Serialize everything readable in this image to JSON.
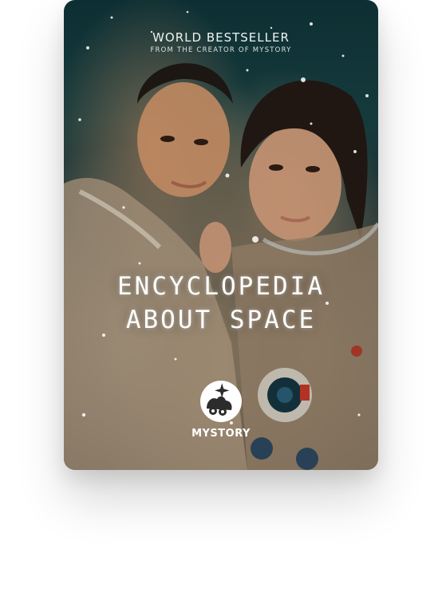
{
  "cover": {
    "kicker": "WORLD BESTSELLER",
    "subkicker": "FROM THE CREATOR OF MYSTORY",
    "title_line_1": "ENCYCLOPEDIA",
    "title_line_2": "ABOUT SPACE",
    "brand": "MYSTORY"
  },
  "colors": {
    "text": "#ffffff",
    "background_top": "#0d2f33",
    "background_bottom": "#2a2a26"
  },
  "icons": {
    "logo": "mystory-logo-icon"
  }
}
